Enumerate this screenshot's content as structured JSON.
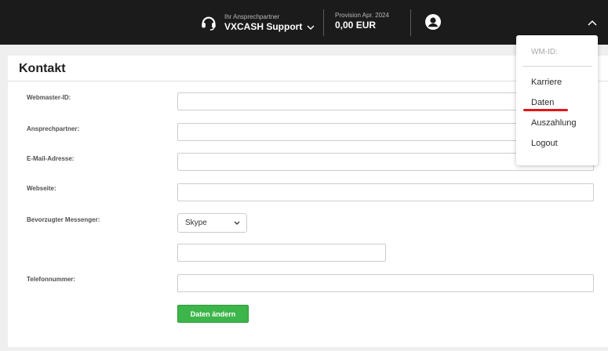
{
  "header": {
    "contact_label": "Ihr Ansprechpartner",
    "contact_name": "VXCASH Support",
    "provision_label": "Provision Apr. 2024",
    "provision_value": "0,00 EUR",
    "icons": [
      "headset-icon",
      "chevron-down-icon",
      "user-icon",
      "chevron-up-icon"
    ]
  },
  "page": {
    "title": "Kontakt"
  },
  "form": {
    "fields": [
      {
        "label": "Webmaster-ID:",
        "value": ""
      },
      {
        "label": "Ansprechpartner:",
        "value": ""
      },
      {
        "label": "E-Mail-Adresse:",
        "value": ""
      },
      {
        "label": "Webseite:",
        "value": ""
      },
      {
        "label": "Bevorzugter Messenger:",
        "value": "Skype"
      },
      {
        "label": "",
        "value": ""
      },
      {
        "label": "Telefonnummer:",
        "value": ""
      }
    ],
    "submit_label": "Daten ändern"
  },
  "menu": {
    "wm_id_label": "WM-ID:",
    "items": [
      {
        "label": "Karriere"
      },
      {
        "label": "Daten"
      },
      {
        "label": "Auszahlung"
      },
      {
        "label": "Logout"
      }
    ]
  },
  "colors": {
    "topbar": "#1b1b1b",
    "accent_green": "#3cb54a",
    "highlight_red": "#e3151a"
  }
}
